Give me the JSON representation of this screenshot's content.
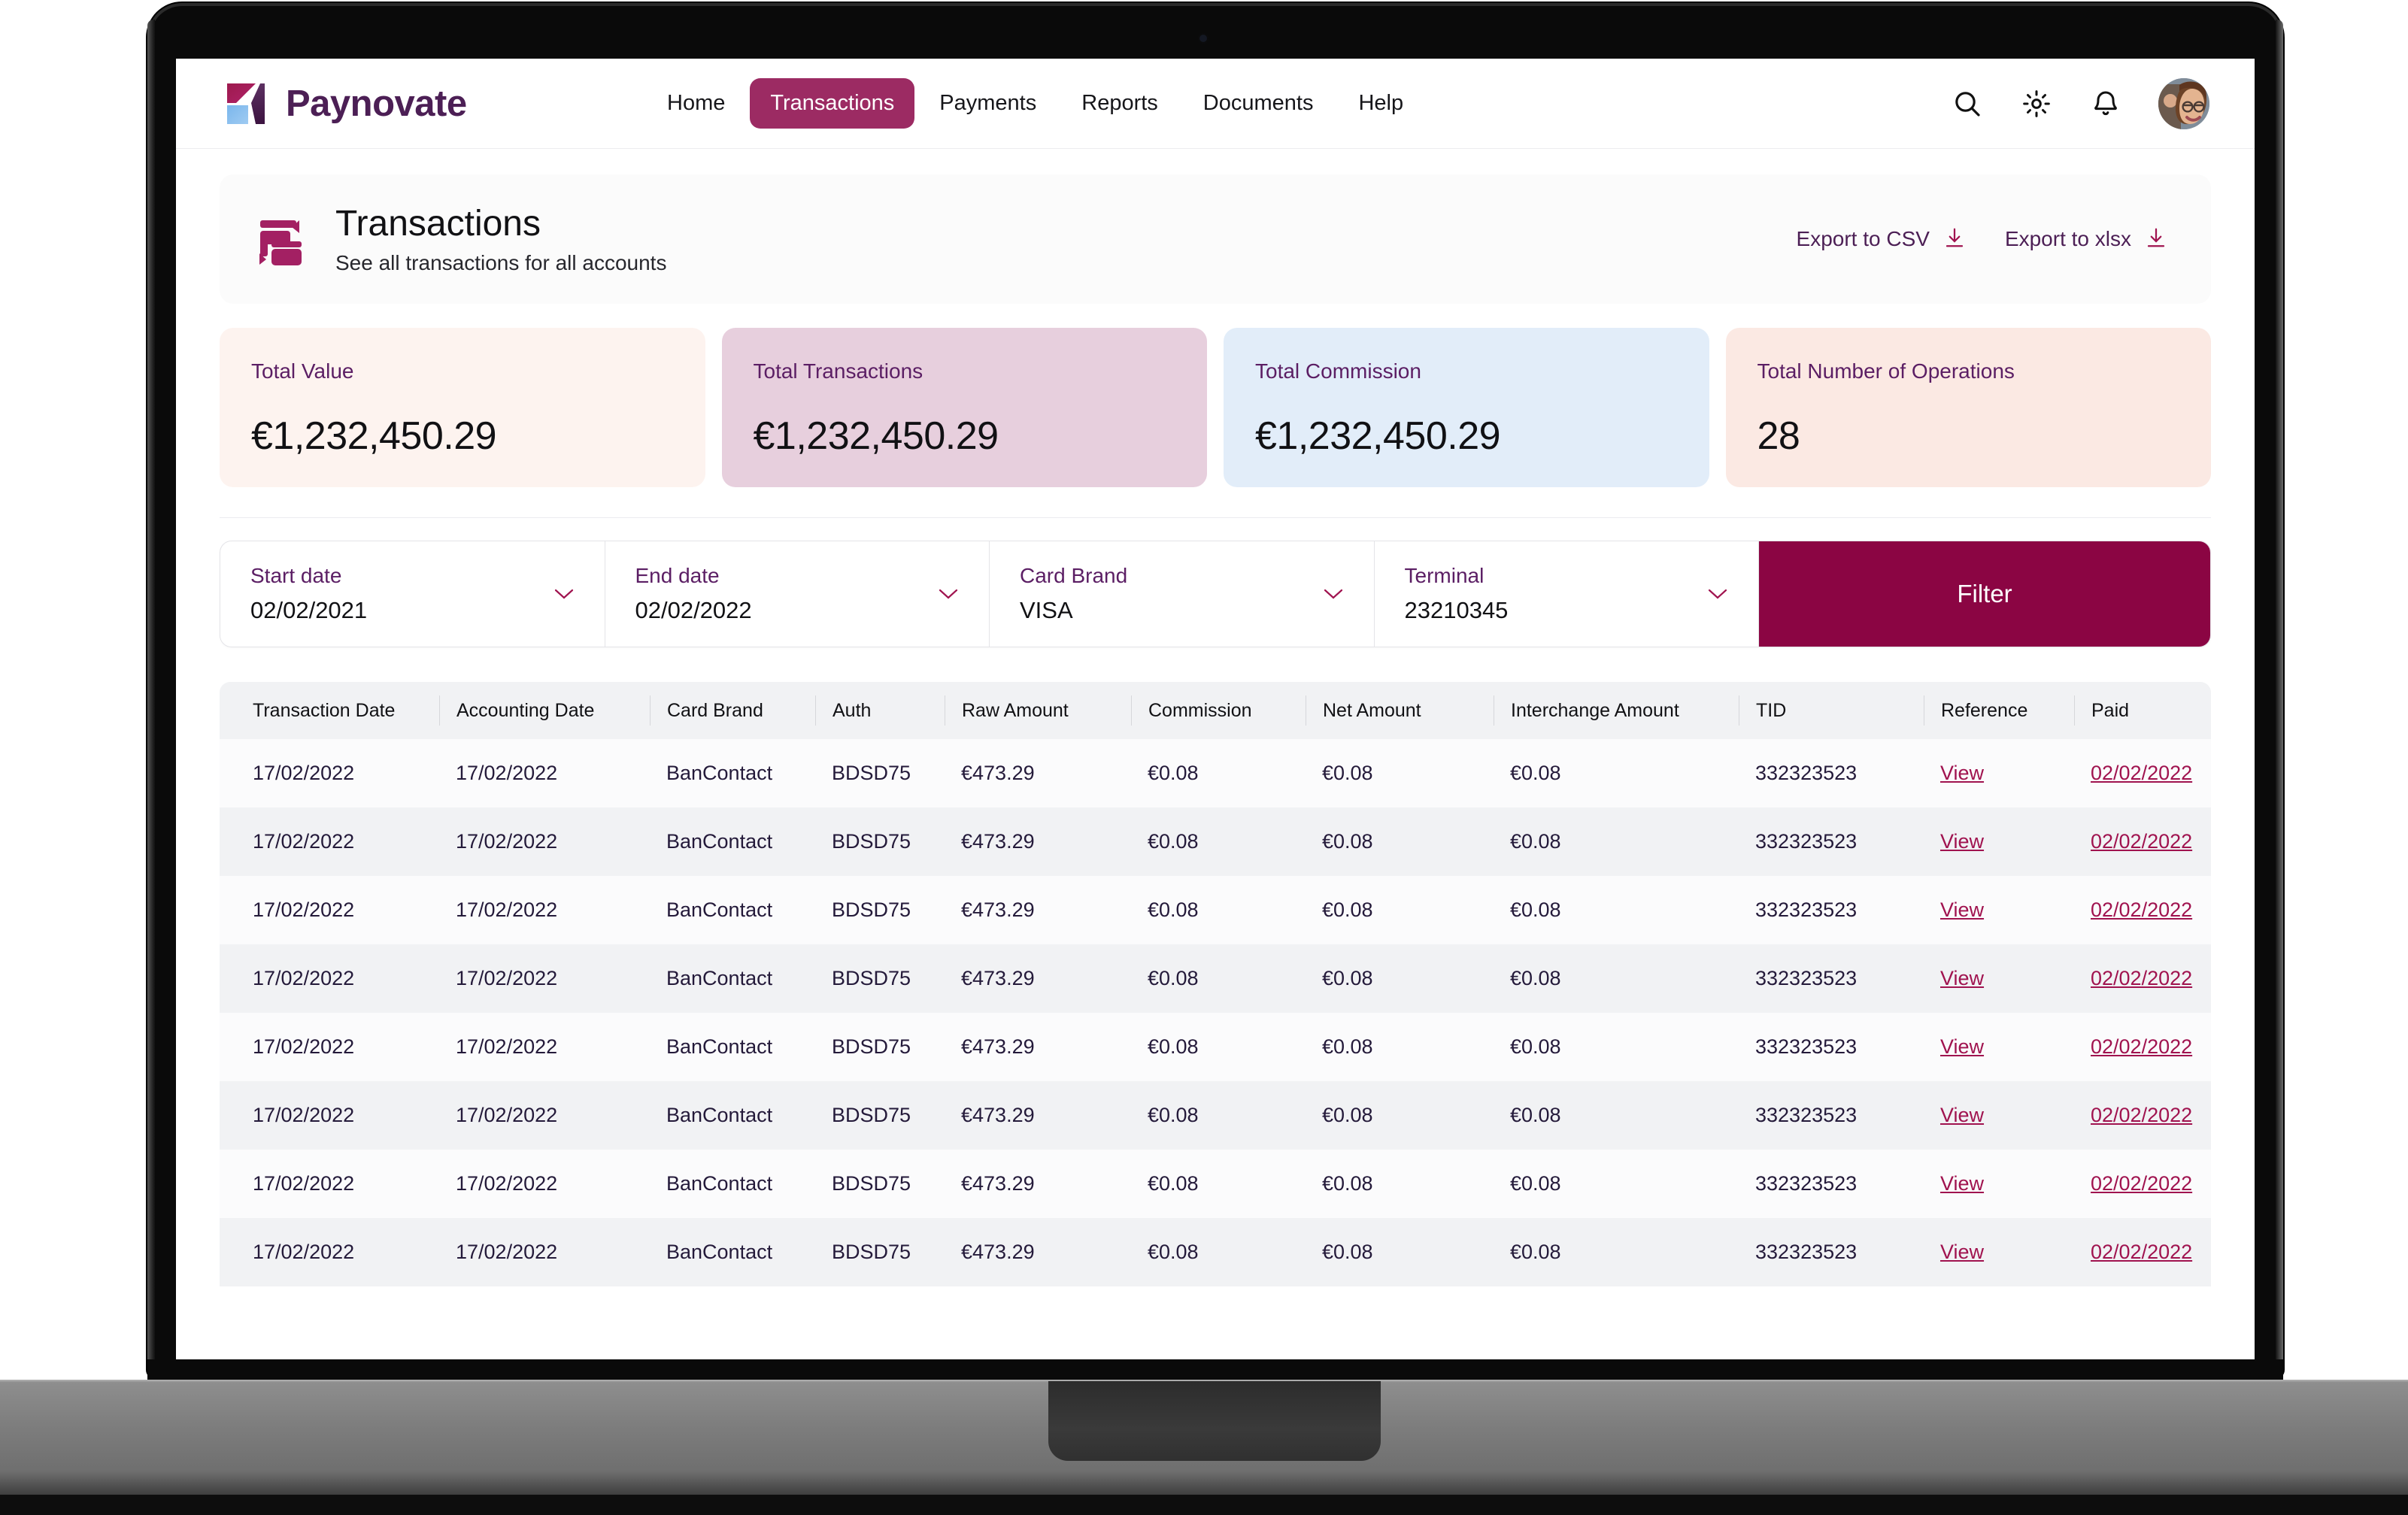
{
  "brand": {
    "name": "Paynovate",
    "accent": "#8b0543",
    "nav_active_bg": "#9c2b63",
    "purple": "#4c1f55"
  },
  "nav": {
    "items": [
      {
        "label": "Home",
        "active": false
      },
      {
        "label": "Transactions",
        "active": true
      },
      {
        "label": "Payments",
        "active": false
      },
      {
        "label": "Reports",
        "active": false
      },
      {
        "label": "Documents",
        "active": false
      },
      {
        "label": "Help",
        "active": false
      }
    ],
    "icons": [
      "search-icon",
      "gear-icon",
      "bell-icon",
      "avatar"
    ]
  },
  "page_header": {
    "icon": "transactions-cards-icon",
    "title": "Transactions",
    "subtitle": "See all transactions for all accounts",
    "export_csv": "Export to CSV",
    "export_xlsx": "Export to xlsx"
  },
  "stats": [
    {
      "label": "Total Value",
      "value": "€1,232,450.29",
      "bg": "#fdf3ef"
    },
    {
      "label": "Total Transactions",
      "value": "€1,232,450.29",
      "bg": "#e7cfdd"
    },
    {
      "label": "Total Commission",
      "value": "€1,232,450.29",
      "bg": "#e2edf9"
    },
    {
      "label": "Total Number of Operations",
      "value": "28",
      "bg": "#fbe9e3"
    }
  ],
  "filters": {
    "fields": [
      {
        "label": "Start date",
        "value": "02/02/2021"
      },
      {
        "label": "End date",
        "value": "02/02/2022"
      },
      {
        "label": "Card Brand",
        "value": "VISA"
      },
      {
        "label": "Terminal",
        "value": "23210345"
      }
    ],
    "button": "Filter"
  },
  "table": {
    "columns": [
      "Transaction Date",
      "Accounting Date",
      "Card Brand",
      "Auth",
      "Raw Amount",
      "Commission",
      "Net Amount",
      "Interchange Amount",
      "TID",
      "Reference",
      "Paid"
    ],
    "rows": [
      [
        "17/02/2022",
        "17/02/2022",
        "BanContact",
        "BDSD75",
        "€473.29",
        "€0.08",
        "€0.08",
        "€0.08",
        "332323523",
        "View",
        "02/02/2022"
      ],
      [
        "17/02/2022",
        "17/02/2022",
        "BanContact",
        "BDSD75",
        "€473.29",
        "€0.08",
        "€0.08",
        "€0.08",
        "332323523",
        "View",
        "02/02/2022"
      ],
      [
        "17/02/2022",
        "17/02/2022",
        "BanContact",
        "BDSD75",
        "€473.29",
        "€0.08",
        "€0.08",
        "€0.08",
        "332323523",
        "View",
        "02/02/2022"
      ],
      [
        "17/02/2022",
        "17/02/2022",
        "BanContact",
        "BDSD75",
        "€473.29",
        "€0.08",
        "€0.08",
        "€0.08",
        "332323523",
        "View",
        "02/02/2022"
      ],
      [
        "17/02/2022",
        "17/02/2022",
        "BanContact",
        "BDSD75",
        "€473.29",
        "€0.08",
        "€0.08",
        "€0.08",
        "332323523",
        "View",
        "02/02/2022"
      ],
      [
        "17/02/2022",
        "17/02/2022",
        "BanContact",
        "BDSD75",
        "€473.29",
        "€0.08",
        "€0.08",
        "€0.08",
        "332323523",
        "View",
        "02/02/2022"
      ],
      [
        "17/02/2022",
        "17/02/2022",
        "BanContact",
        "BDSD75",
        "€473.29",
        "€0.08",
        "€0.08",
        "€0.08",
        "332323523",
        "View",
        "02/02/2022"
      ],
      [
        "17/02/2022",
        "17/02/2022",
        "BanContact",
        "BDSD75",
        "€473.29",
        "€0.08",
        "€0.08",
        "€0.08",
        "332323523",
        "View",
        "02/02/2022"
      ]
    ],
    "link_columns": [
      9,
      10
    ]
  }
}
